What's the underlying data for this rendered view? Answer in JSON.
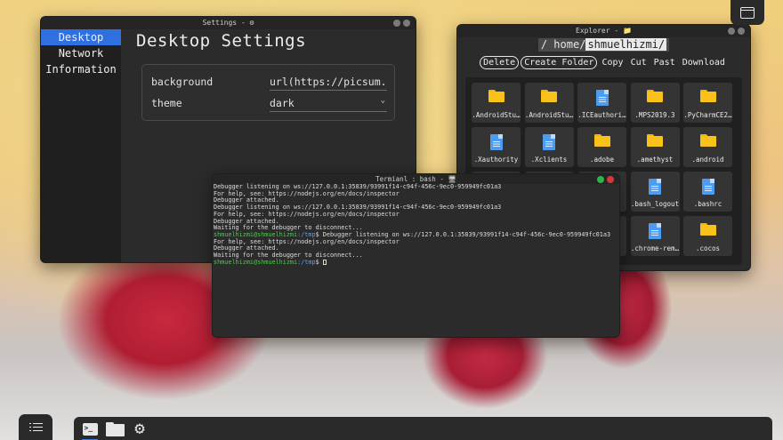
{
  "settings_window": {
    "title": "Settings - ⚙",
    "sidebar": [
      {
        "label": "Desktop",
        "active": true
      },
      {
        "label": "Network",
        "active": false
      },
      {
        "label": "Information",
        "active": false
      }
    ],
    "heading": "Desktop Settings",
    "rows": [
      {
        "label": "background",
        "value": "url(https://picsum.ph"
      },
      {
        "label": "theme",
        "value": "dark"
      }
    ]
  },
  "explorer_window": {
    "title": "Explorer - 📁",
    "path": {
      "prefix": "/ home/",
      "highlight": "shmuelhizmi/"
    },
    "toolbar": [
      "Delete",
      "Create Folder",
      "Copy",
      "Cut",
      "Past",
      "Download"
    ],
    "files": [
      {
        "name": ".AndroidStu…",
        "icon": "folder-icon"
      },
      {
        "name": ".AndroidStu…",
        "icon": "folder-icon"
      },
      {
        "name": ".ICEauthori…",
        "icon": "file-icon"
      },
      {
        "name": ".MPS2019.3",
        "icon": "folder-icon"
      },
      {
        "name": ".PyCharmCE2…",
        "icon": "folder-icon"
      },
      {
        "name": ".Xauthority",
        "icon": "file-icon"
      },
      {
        "name": ".Xclients",
        "icon": "file-icon"
      },
      {
        "name": ".adobe",
        "icon": "folder-icon"
      },
      {
        "name": ".amethyst",
        "icon": "folder-icon"
      },
      {
        "name": ".android",
        "icon": "folder-icon"
      },
      {
        "name": "",
        "icon": "folder-icon"
      },
      {
        "name": "",
        "icon": "folder-icon"
      },
      {
        "name": "",
        "icon": "folder-icon"
      },
      {
        "name": ".bash_logout",
        "icon": "file-icon"
      },
      {
        "name": ".bashrc",
        "icon": "file-icon"
      },
      {
        "name": "",
        "icon": "folder-icon"
      },
      {
        "name": "",
        "icon": "folder-icon"
      },
      {
        "name": "",
        "icon": "folder-icon"
      },
      {
        "name": ".chrome-rem…",
        "icon": "file-icon"
      },
      {
        "name": ".cocos",
        "icon": "folder-icon"
      }
    ]
  },
  "terminal_window": {
    "title": "Termianl : bash - 🖥",
    "lines": [
      {
        "text": "Debugger listening on ws://127.0.0.1:35839/93991f14-c94f-456c-9ec0-959949fc01a3"
      },
      {
        "text": "For help, see: https://nodejs.org/en/docs/inspector"
      },
      {
        "text": "Debugger attached."
      },
      {
        "text": "Debugger listening on ws://127.0.0.1:35839/93991f14-c94f-456c-9ec0-959949fc01a3"
      },
      {
        "text": "For help, see: https://nodejs.org/en/docs/inspector"
      },
      {
        "text": "Debugger attached."
      },
      {
        "text": "Waiting for the debugger to disconnect..."
      },
      {
        "user": "shmuelhizmi@shmuelhizmi",
        "path": ":/tmp",
        "text": "$ Debugger listening on ws://127.0.0.1:35839/93991f14-c94f-456c-9ec0-959949fc01a3"
      },
      {
        "text": "For help, see: https://nodejs.org/en/docs/inspector"
      },
      {
        "text": "Debugger attached."
      },
      {
        "text": "Waiting for the debugger to disconnect..."
      },
      {
        "user": "shmuelhizmi@shmuelhizmi",
        "path": ":/tmp",
        "text": "$ ",
        "cursor": true
      }
    ]
  },
  "top_right_button": {
    "icon": "window-icon"
  },
  "menu_button": {
    "icon": "menu-icon"
  },
  "taskbar": [
    {
      "icon": "terminal-icon",
      "active": true
    },
    {
      "icon": "folder-icon",
      "active": false
    },
    {
      "icon": "gear-icon",
      "active": false
    }
  ],
  "colors": {
    "accent": "#2f6fe0",
    "folder": "#f9c21b",
    "file": "#4d9cf0",
    "prompt_user": "#4ec94e",
    "prompt_path": "#5aa0f0"
  }
}
